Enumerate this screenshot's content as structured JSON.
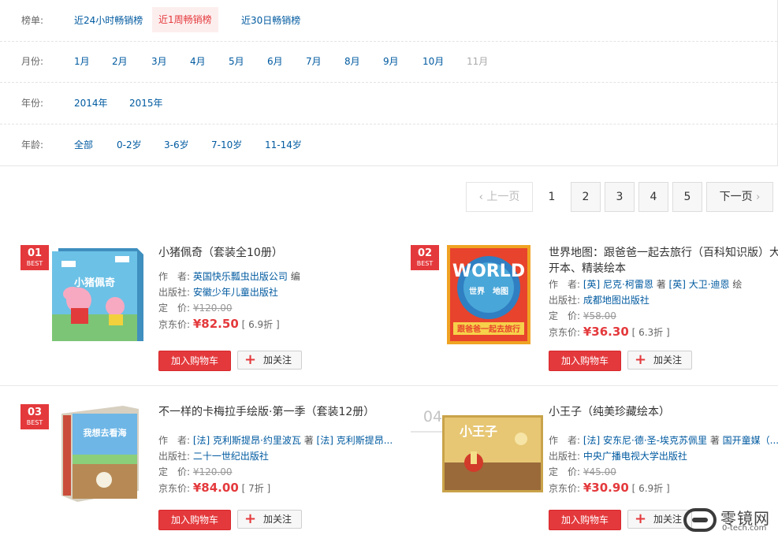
{
  "filters": {
    "list": {
      "label": "榜单:",
      "options": [
        {
          "label": "近24小时畅销榜",
          "state": "normal"
        },
        {
          "label": "近1周畅销榜",
          "state": "selected"
        },
        {
          "label": "近30日畅销榜",
          "state": "normal"
        }
      ]
    },
    "month": {
      "label": "月份:",
      "options": [
        {
          "label": "1月",
          "state": "normal"
        },
        {
          "label": "2月",
          "state": "normal"
        },
        {
          "label": "3月",
          "state": "normal"
        },
        {
          "label": "4月",
          "state": "normal"
        },
        {
          "label": "5月",
          "state": "normal"
        },
        {
          "label": "6月",
          "state": "normal"
        },
        {
          "label": "7月",
          "state": "normal"
        },
        {
          "label": "8月",
          "state": "normal"
        },
        {
          "label": "9月",
          "state": "normal"
        },
        {
          "label": "10月",
          "state": "normal"
        },
        {
          "label": "11月",
          "state": "disabled"
        }
      ]
    },
    "year": {
      "label": "年份:",
      "options": [
        {
          "label": "2014年",
          "state": "normal"
        },
        {
          "label": "2015年",
          "state": "normal"
        }
      ]
    },
    "age": {
      "label": "年龄:",
      "options": [
        {
          "label": "全部",
          "state": "normal"
        },
        {
          "label": "0-2岁",
          "state": "normal"
        },
        {
          "label": "3-6岁",
          "state": "normal"
        },
        {
          "label": "7-10岁",
          "state": "normal"
        },
        {
          "label": "11-14岁",
          "state": "normal"
        }
      ]
    }
  },
  "pager": {
    "prev": "上一页",
    "pages": [
      "1",
      "2",
      "3",
      "4",
      "5"
    ],
    "current": "1",
    "next": "下一页"
  },
  "labels": {
    "author": "作　者:",
    "publisher": "出版社:",
    "list_price": "定　价:",
    "jd_price": "京东价:",
    "add_to_cart": "加入购物车",
    "follow": "加关注",
    "best": "BEST"
  },
  "books": [
    {
      "rank": "01",
      "ranked_badge": true,
      "title": "小猪佩奇（套装全10册）",
      "authors": [
        {
          "text": "英国快乐瓢虫出版公司",
          "link": true
        },
        {
          "text": " 编",
          "link": false
        }
      ],
      "publisher": "安徽少年儿童出版社",
      "list_price": "¥120.00",
      "jd_price": "¥82.50",
      "discount": "[ 6.9折 ]",
      "cover_text": "小猪佩奇",
      "cover_color": "#5fb6de"
    },
    {
      "rank": "02",
      "ranked_badge": true,
      "title": "世界地图：跟爸爸一起去旅行（百科知识版）大开本、精装绘本",
      "authors": [
        {
          "text": "[英] 尼克·柯雷恩",
          "link": true
        },
        {
          "text": " 著 ",
          "link": false
        },
        {
          "text": "[英] 大卫·迪恩",
          "link": true
        },
        {
          "text": " 绘",
          "link": false
        }
      ],
      "publisher": "成都地图出版社",
      "list_price": "¥58.00",
      "jd_price": "¥36.30",
      "discount": "[ 6.3折 ]",
      "cover_text": "WORLD",
      "cover_subtext": "跟爸爸一起去旅行",
      "cover_mid": "世界　地图",
      "cover_color": "#e8432c"
    },
    {
      "rank": "03",
      "ranked_badge": true,
      "title": "不一样的卡梅拉手绘版·第一季（套装12册）",
      "authors": [
        {
          "text": "[法] 克利斯提昂·约里波瓦",
          "link": true
        },
        {
          "text": " 著 ",
          "link": false
        },
        {
          "text": "[法] 克利斯提昂...",
          "link": true
        }
      ],
      "publisher": "二十一世纪出版社",
      "list_price": "¥120.00",
      "jd_price": "¥84.00",
      "discount": "[ 7折 ]",
      "cover_text": "我想去看海",
      "cover_color": "#4aa3dc"
    },
    {
      "rank": "04",
      "ranked_badge": false,
      "title": "小王子（纯美珍藏绘本）",
      "authors": [
        {
          "text": "[法] 安东尼·德·圣-埃克苏佩里",
          "link": true
        },
        {
          "text": " 著 ",
          "link": false
        },
        {
          "text": "国开童媒（...",
          "link": true
        }
      ],
      "publisher": "中央广播电视大学出版社",
      "list_price": "¥45.00",
      "jd_price": "¥30.90",
      "discount": "[ 6.9折 ]",
      "cover_text": "小王子",
      "cover_color": "#d9b15a"
    }
  ],
  "watermark": {
    "text": "零镜网",
    "url": "0-tech.com"
  }
}
